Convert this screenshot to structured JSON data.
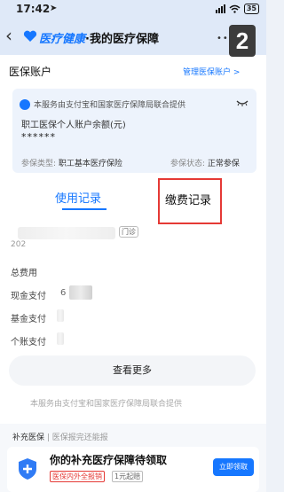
{
  "status_bar": {
    "time": "17:42",
    "battery": "35"
  },
  "nav": {
    "back": "‹",
    "brand": "医疗健康",
    "separator": "·",
    "title": "我的医疗保障",
    "more": "•••"
  },
  "overlay_badge": "2",
  "account": {
    "section_title": "医保账户",
    "manage_link": "管理医保账户 >",
    "provider": "本服务由支付宝和国家医疗保障局联合提供",
    "balance_label": "职工医保个人账户余额(元)",
    "balance_value": "******",
    "insurance_type_label": "参保类型:",
    "insurance_type_value": "职工基本医疗保险",
    "status_label": "参保状态:",
    "status_value": "正常参保"
  },
  "tabs": {
    "use_records": "使用记录",
    "payment_records": "缴费记录"
  },
  "record": {
    "date_prefix": "202",
    "tag": "门诊",
    "rows": [
      {
        "label": "总费用"
      },
      {
        "label": "现金支付",
        "value": "6"
      },
      {
        "label": "基金支付"
      },
      {
        "label": "个账支付"
      }
    ],
    "more_button": "查看更多"
  },
  "footer_note": "本服务由支付宝和国家医疗保障局联合提供",
  "supplement": {
    "header": "补充医保",
    "header_sub": "医保报完还能报",
    "title": "你的补充医疗保障待领取",
    "tag1": "医保内外全报销",
    "tag2": "1元起赔",
    "button": "立即领取"
  },
  "colors": {
    "accent": "#1677ff",
    "highlight_box": "#e53935",
    "nav_bg": "#dfe9f8"
  },
  "icons": {
    "back": "chevron-left-icon",
    "eye": "eye-closed-icon",
    "shield": "shield-plus-icon"
  }
}
